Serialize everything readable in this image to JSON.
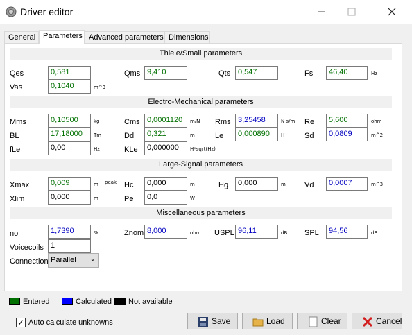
{
  "window": {
    "title": "Driver editor"
  },
  "tabs": [
    "General",
    "Parameters",
    "Advanced parameters",
    "Dimensions"
  ],
  "sections": {
    "thiele": "Thiele/Small parameters",
    "electro": "Electro-Mechanical parameters",
    "large": "Large-Signal parameters",
    "misc": "Miscellaneous parameters"
  },
  "thiele": {
    "qes": {
      "label": "Qes",
      "value": "0,581",
      "state": "entered"
    },
    "qms": {
      "label": "Qms",
      "value": "9,410",
      "state": "entered"
    },
    "qts": {
      "label": "Qts",
      "value": "0,547",
      "state": "entered"
    },
    "fs": {
      "label": "Fs",
      "value": "46,40",
      "unit": "Hz",
      "state": "entered"
    },
    "vas": {
      "label": "Vas",
      "value": "0,1040",
      "unit": "m^3",
      "state": "entered"
    }
  },
  "electro": {
    "mms": {
      "label": "Mms",
      "value": "0,10500",
      "unit": "kg",
      "state": "entered"
    },
    "cms": {
      "label": "Cms",
      "value": "0,0001120",
      "unit": "m/N",
      "state": "entered"
    },
    "rms": {
      "label": "Rms",
      "value": "3,25458",
      "unit": "N·s/m",
      "state": "calculated"
    },
    "re": {
      "label": "Re",
      "value": "5,600",
      "unit": "ohm",
      "state": "entered"
    },
    "bl": {
      "label": "BL",
      "value": "17,18000",
      "unit": "Tm",
      "state": "entered"
    },
    "dd": {
      "label": "Dd",
      "value": "0,321",
      "unit": "m",
      "state": "entered"
    },
    "le": {
      "label": "Le",
      "value": "0,000890",
      "unit": "H",
      "state": "entered"
    },
    "sd": {
      "label": "Sd",
      "value": "0,0809",
      "unit": "m^2",
      "state": "calculated"
    },
    "fle": {
      "label": "fLe",
      "value": "0,00",
      "unit": "Hz",
      "state": "na"
    },
    "kle": {
      "label": "KLe",
      "value": "0,000000",
      "unit": "H*sqrt(Hz)",
      "state": "na"
    }
  },
  "large": {
    "xmax": {
      "label": "Xmax",
      "value": "0,009",
      "unit": "m",
      "unit2": "peak",
      "state": "entered"
    },
    "hc": {
      "label": "Hc",
      "value": "0,000",
      "unit": "m",
      "state": "na"
    },
    "hg": {
      "label": "Hg",
      "value": "0,000",
      "unit": "m",
      "state": "na"
    },
    "vd": {
      "label": "Vd",
      "value": "0,0007",
      "unit": "m^3",
      "state": "calculated"
    },
    "xlim": {
      "label": "Xlim",
      "value": "0,000",
      "unit": "m",
      "state": "na"
    },
    "pe": {
      "label": "Pe",
      "value": "0,0",
      "unit": "W",
      "state": "na"
    }
  },
  "misc": {
    "no": {
      "label": "no",
      "value": "1,7390",
      "unit": "%",
      "state": "calculated"
    },
    "znom": {
      "label": "Znom",
      "value": "8,000",
      "unit": "ohm",
      "state": "calculated"
    },
    "uspl": {
      "label": "USPL",
      "value": "96,11",
      "unit": "dB",
      "state": "calculated"
    },
    "spl": {
      "label": "SPL",
      "value": "94,56",
      "unit": "dB",
      "state": "calculated"
    },
    "voicecoils": {
      "label": "Voicecoils",
      "value": "1"
    },
    "connection": {
      "label": "Connection",
      "value": "Parallel"
    }
  },
  "legend": {
    "entered": {
      "label": "Entered",
      "color": "#007000"
    },
    "calculated": {
      "label": "Calculated",
      "color": "#0000ff"
    },
    "na": {
      "label": "Not available",
      "color": "#000000"
    }
  },
  "auto_calc": {
    "label": "Auto calculate unknowns",
    "checked": true
  },
  "buttons": {
    "save": "Save",
    "load": "Load",
    "clear": "Clear",
    "cancel": "Cancel"
  },
  "icons": {
    "app": "speaker-app-icon",
    "minimize": "minimize-icon",
    "maximize": "maximize-icon",
    "close": "close-icon",
    "save": "floppy-disk-icon",
    "load": "folder-open-icon",
    "clear": "blank-page-icon",
    "cancel": "red-x-icon"
  }
}
